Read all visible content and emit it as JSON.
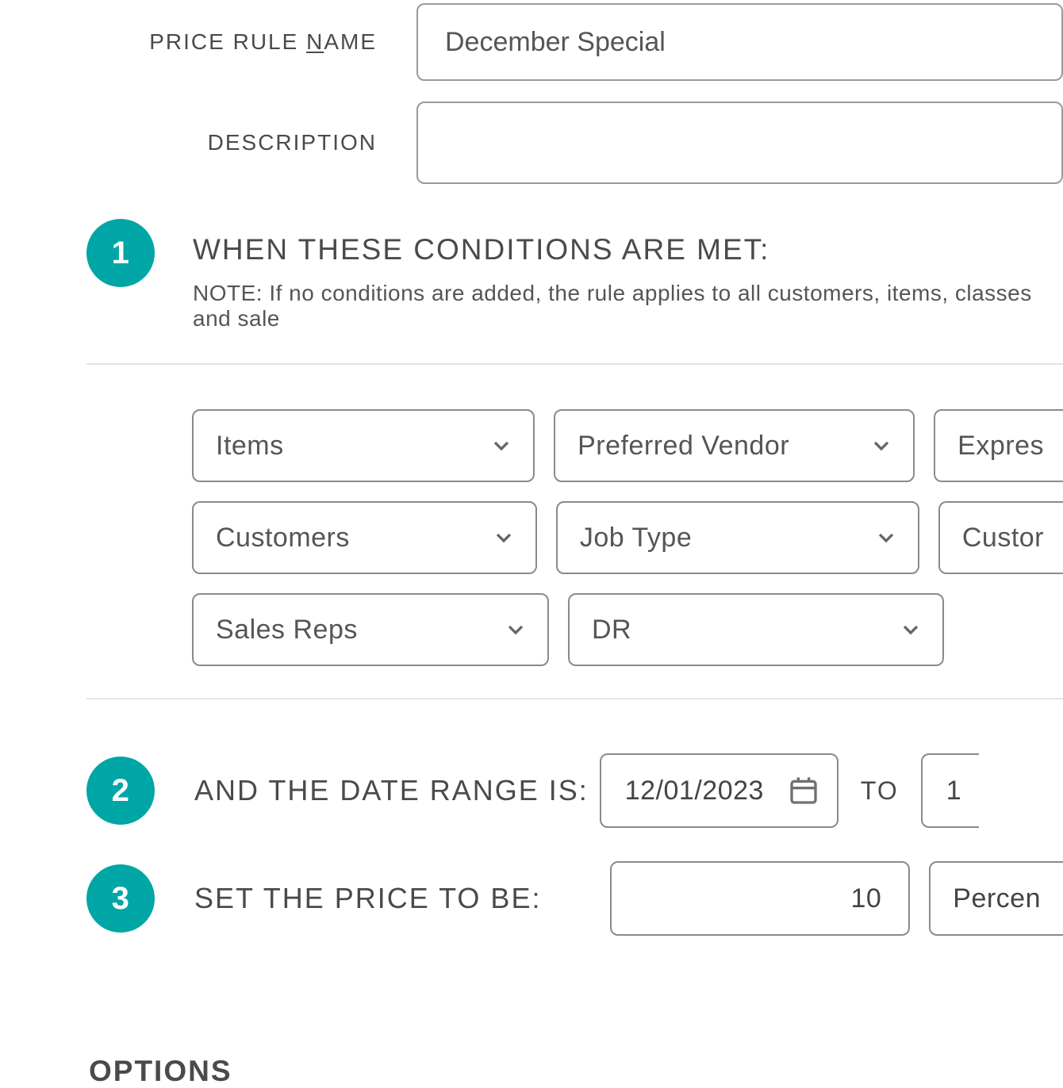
{
  "form": {
    "name_label_pre": "PRICE RULE ",
    "name_label_u": "N",
    "name_label_post": "AME",
    "name_value": "December Special",
    "desc_label": "DESCRIPTION",
    "desc_value": ""
  },
  "step1": {
    "num": "1",
    "heading": "WHEN THESE CONDITIONS ARE MET:",
    "note": "NOTE: If no conditions are added, the rule applies to all customers, items, classes and sale"
  },
  "conditions": {
    "r1": {
      "c1": "Items",
      "c2": "Preferred Vendor",
      "c3": "Expres"
    },
    "r2": {
      "c1": "Customers",
      "c2": "Job Type",
      "c3": "Custor"
    },
    "r3": {
      "c1": "Sales Reps",
      "c2": "DR"
    }
  },
  "step2": {
    "num": "2",
    "label": "AND THE DATE RANGE IS:",
    "start_date": "12/01/2023",
    "to": "TO",
    "end_date": "1"
  },
  "step3": {
    "num": "3",
    "label": "SET THE PRICE TO BE:",
    "value": "10",
    "unit": "Percen"
  },
  "options_heading": "OPTIONS"
}
